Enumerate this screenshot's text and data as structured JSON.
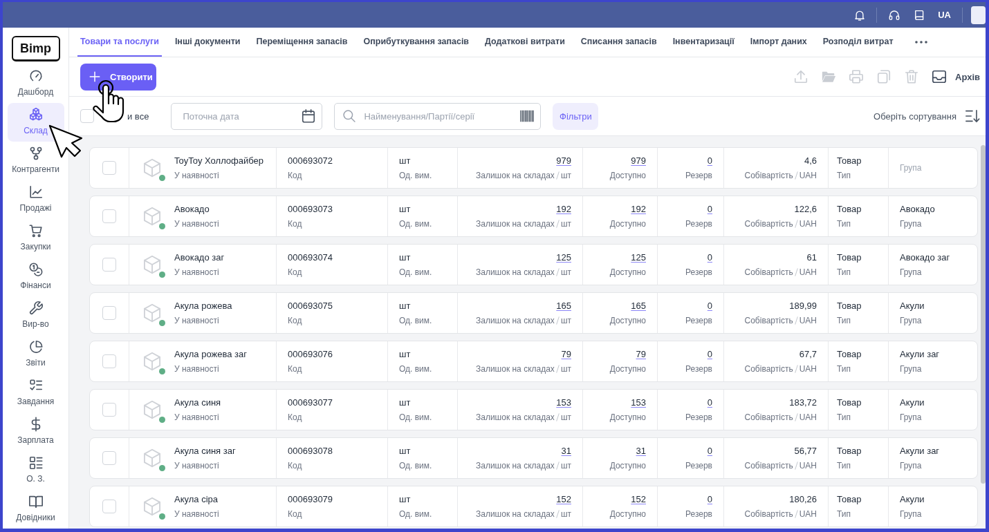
{
  "topbar": {
    "language": "UA"
  },
  "sidebar": {
    "logo": "Bimp",
    "items": [
      {
        "kind": "dashboard",
        "label": "Дашборд",
        "selected": false
      },
      {
        "kind": "warehouse",
        "label": "Склад",
        "selected": true
      },
      {
        "kind": "partners",
        "label": "Контрагенти",
        "selected": false
      },
      {
        "kind": "sales",
        "label": "Продажі",
        "selected": false
      },
      {
        "kind": "purchases",
        "label": "Закупки",
        "selected": false
      },
      {
        "kind": "finance",
        "label": "Фінанси",
        "selected": false
      },
      {
        "kind": "production",
        "label": "Вир-во",
        "selected": false
      },
      {
        "kind": "reports",
        "label": "Звіти",
        "selected": false
      },
      {
        "kind": "tasks",
        "label": "Завдання",
        "selected": false
      },
      {
        "kind": "salary",
        "label": "Зарплата",
        "selected": false
      },
      {
        "kind": "assets",
        "label": "О. З.",
        "selected": false
      },
      {
        "kind": "directories",
        "label": "Довідники",
        "selected": false
      }
    ]
  },
  "tabs": [
    {
      "label": "Товари та послуги",
      "selected": true
    },
    {
      "label": "Інші документи",
      "selected": false
    },
    {
      "label": "Переміщення запасів",
      "selected": false
    },
    {
      "label": "Оприбуткування запасів",
      "selected": false
    },
    {
      "label": "Додаткові витрати",
      "selected": false
    },
    {
      "label": "Списання запасів",
      "selected": false
    },
    {
      "label": "Інвентаризації",
      "selected": false
    },
    {
      "label": "Імпорт даних",
      "selected": false
    },
    {
      "label": "Розподіл витрат",
      "selected": false
    }
  ],
  "toolbar": {
    "create_button": "Створити",
    "actions": [
      {
        "kind": "upload",
        "disabled": true
      },
      {
        "kind": "folder",
        "disabled": true
      },
      {
        "kind": "print",
        "disabled": true
      },
      {
        "kind": "copy",
        "disabled": true
      },
      {
        "kind": "trash",
        "disabled": true
      },
      {
        "kind": "archive",
        "disabled": false,
        "label": "Архів"
      }
    ]
  },
  "filter_bar": {
    "select_all": {
      "label": "и все",
      "checked": false
    },
    "date_field": {
      "placeholder": "Поточна дата"
    },
    "search_field": {
      "placeholder": "Найменування/Партії/серії"
    },
    "filters_button": "Фільтри",
    "sort_label": "Оберіть сортування"
  },
  "rows": [
    {
      "selected": false,
      "name": "ToyToy Холлофайбер",
      "status": "У наявності",
      "code": "000693072",
      "code_label": "Код",
      "unit": "шт",
      "unit_label": "Од. вим.",
      "stock": "979",
      "stock_label": "Залишок на складах",
      "stock_unit": "шт",
      "available": "979",
      "available_label": "Доступно",
      "reserve": "0",
      "reserve_label": "Резерв",
      "cost": "4,6",
      "cost_label": "Собівартість",
      "currency": "UAH",
      "type": "Товар",
      "type_label": "Тип",
      "group_label": "Група"
    },
    {
      "selected": false,
      "name": "Авокадо",
      "status": "У наявності",
      "code": "000693073",
      "code_label": "Код",
      "unit": "шт",
      "unit_label": "Од. вим.",
      "stock": "192",
      "stock_label": "Залишок на складах",
      "stock_unit": "шт",
      "available": "192",
      "available_label": "Доступно",
      "reserve": "0",
      "reserve_label": "Резерв",
      "cost": "122,6",
      "cost_label": "Собівартість",
      "currency": "UAH",
      "type": "Товар",
      "type_label": "Тип",
      "group": "Авокадо",
      "group_label": "Група"
    },
    {
      "selected": false,
      "name": "Авокадо заг",
      "status": "У наявності",
      "code": "000693074",
      "code_label": "Код",
      "unit": "шт",
      "unit_label": "Од. вим.",
      "stock": "125",
      "stock_label": "Залишок на складах",
      "stock_unit": "шт",
      "available": "125",
      "available_label": "Доступно",
      "reserve": "0",
      "reserve_label": "Резерв",
      "cost": "61",
      "cost_label": "Собівартість",
      "currency": "UAH",
      "type": "Товар",
      "type_label": "Тип",
      "group": "Авокадо заг",
      "group_label": "Група"
    },
    {
      "selected": false,
      "name": "Акула рожева",
      "status": "У наявності",
      "code": "000693075",
      "code_label": "Код",
      "unit": "шт",
      "unit_label": "Од. вим.",
      "stock": "165",
      "stock_label": "Залишок на складах",
      "stock_unit": "шт",
      "available": "165",
      "available_label": "Доступно",
      "reserve": "0",
      "reserve_label": "Резерв",
      "cost": "189,99",
      "cost_label": "Собівартість",
      "currency": "UAH",
      "type": "Товар",
      "type_label": "Тип",
      "group": "Акули",
      "group_label": "Група"
    },
    {
      "selected": false,
      "name": "Акула рожева заг",
      "status": "У наявності",
      "code": "000693076",
      "code_label": "Код",
      "unit": "шт",
      "unit_label": "Од. вим.",
      "stock": "79",
      "stock_label": "Залишок на складах",
      "stock_unit": "шт",
      "available": "79",
      "available_label": "Доступно",
      "reserve": "0",
      "reserve_label": "Резерв",
      "cost": "67,7",
      "cost_label": "Собівартість",
      "currency": "UAH",
      "type": "Товар",
      "type_label": "Тип",
      "group": "Акули заг",
      "group_label": "Група"
    },
    {
      "selected": false,
      "name": "Акула синя",
      "status": "У наявності",
      "code": "000693077",
      "code_label": "Код",
      "unit": "шт",
      "unit_label": "Од. вим.",
      "stock": "153",
      "stock_label": "Залишок на складах",
      "stock_unit": "шт",
      "available": "153",
      "available_label": "Доступно",
      "reserve": "0",
      "reserve_label": "Резерв",
      "cost": "183,72",
      "cost_label": "Собівартість",
      "currency": "UAH",
      "type": "Товар",
      "type_label": "Тип",
      "group": "Акули",
      "group_label": "Група"
    },
    {
      "selected": false,
      "name": "Акула синя заг",
      "status": "У наявності",
      "code": "000693078",
      "code_label": "Код",
      "unit": "шт",
      "unit_label": "Од. вим.",
      "stock": "31",
      "stock_label": "Залишок на складах",
      "stock_unit": "шт",
      "available": "31",
      "available_label": "Доступно",
      "reserve": "0",
      "reserve_label": "Резерв",
      "cost": "56,77",
      "cost_label": "Собівартість",
      "currency": "UAH",
      "type": "Товар",
      "type_label": "Тип",
      "group": "Акули заг",
      "group_label": "Група"
    },
    {
      "selected": false,
      "name": "Акула сіра",
      "status": "У наявності",
      "code": "000693079",
      "code_label": "Код",
      "unit": "шт",
      "unit_label": "Од. вим.",
      "stock": "152",
      "stock_label": "Залишок на складах",
      "stock_unit": "шт",
      "available": "152",
      "available_label": "Доступно",
      "reserve": "0",
      "reserve_label": "Резерв",
      "cost": "180,26",
      "cost_label": "Собівартість",
      "currency": "UAH",
      "type": "Товар",
      "type_label": "Тип",
      "group": "Акули",
      "group_label": "Група"
    }
  ]
}
